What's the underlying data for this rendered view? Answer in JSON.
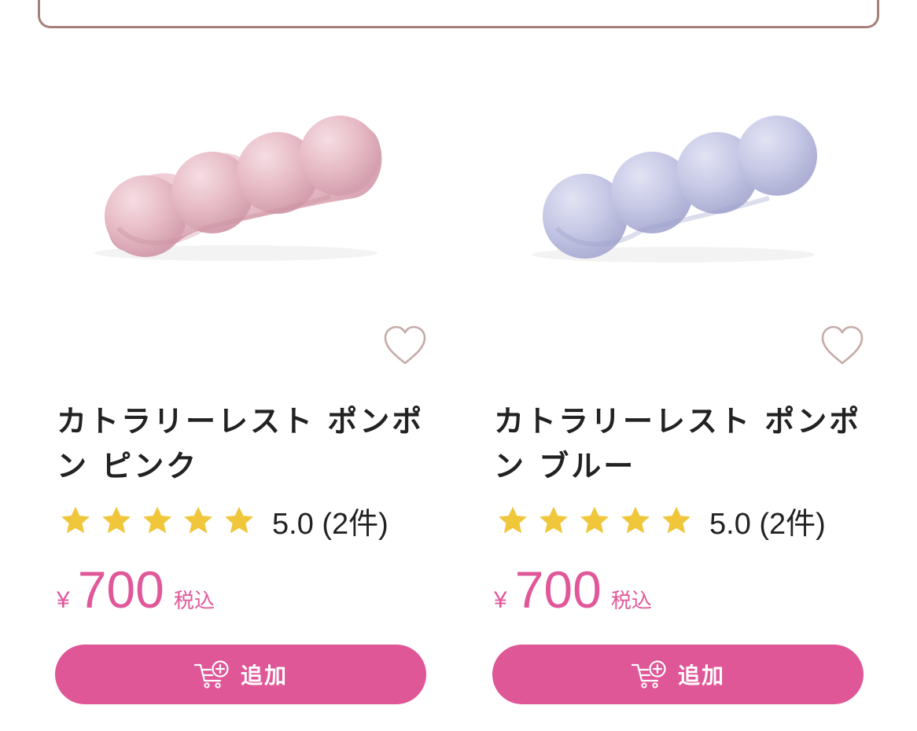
{
  "colors": {
    "accent": "#df5797",
    "price": "#e0589a",
    "star": "#f0c63a",
    "heart": "#c6aca8",
    "border": "#a58078"
  },
  "products": [
    {
      "name": "カトラリーレスト ポンポン ピンク",
      "image_color": "#e8c0c9",
      "rating": 5.0,
      "rating_text": "5.0 (2件)",
      "currency": "¥",
      "price": "700",
      "tax_label": "税込",
      "add_label": "追加",
      "favorite_icon": "heart-outline-icon",
      "cart_icon": "cart-plus-icon"
    },
    {
      "name": "カトラリーレスト ポンポン ブルー",
      "image_color": "#c9cbe6",
      "rating": 5.0,
      "rating_text": "5.0 (2件)",
      "currency": "¥",
      "price": "700",
      "tax_label": "税込",
      "add_label": "追加",
      "favorite_icon": "heart-outline-icon",
      "cart_icon": "cart-plus-icon"
    }
  ]
}
